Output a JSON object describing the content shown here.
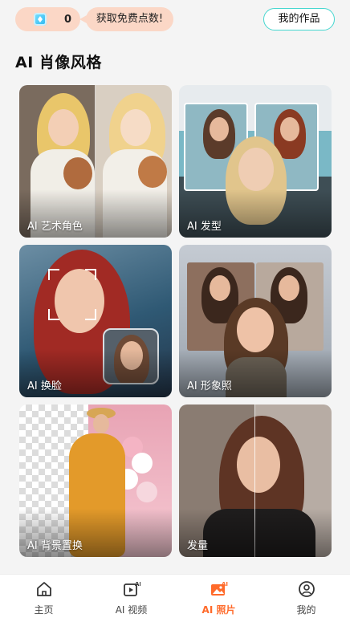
{
  "header": {
    "points": "0",
    "free_tip": "获取免费点数!",
    "my_works": "我的作品"
  },
  "section_title": "AI 肖像风格",
  "cards": [
    {
      "label": "AI 艺术角色"
    },
    {
      "label": "AI 发型"
    },
    {
      "label": "AI 换脸"
    },
    {
      "label": "AI 形象照"
    },
    {
      "label": "AI 背景置换"
    },
    {
      "label": "发量"
    }
  ],
  "nav": [
    {
      "label": "主页",
      "icon": "home-icon"
    },
    {
      "label": "AI 视频",
      "icon": "ai-video-icon"
    },
    {
      "label": "AI 照片",
      "icon": "ai-photo-icon",
      "active": true
    },
    {
      "label": "我的",
      "icon": "profile-icon"
    }
  ],
  "colors": {
    "accent": "#ff6a2a",
    "pill": "#fbd7c6",
    "outline": "#44d6cf"
  }
}
